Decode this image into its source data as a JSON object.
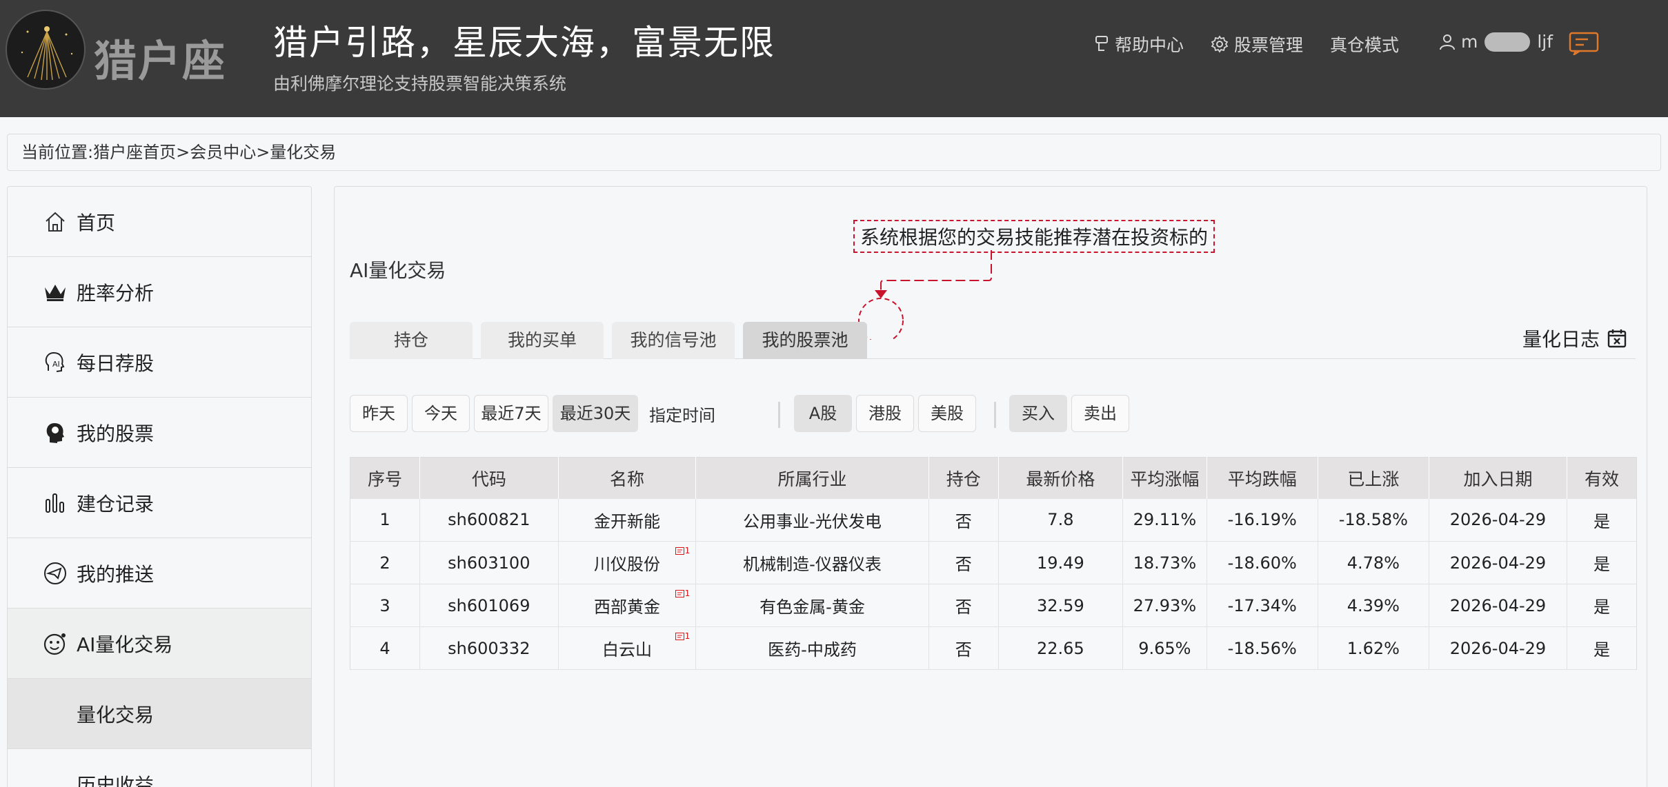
{
  "header": {
    "logo_text": "猎户座",
    "slogan": "猎户引路，星辰大海，富景无限",
    "subslogan": "由利佛摩尔理论支持股票智能决策系统",
    "nav": {
      "help": "帮助中心",
      "stock_manage": "股票管理",
      "real_mode": "真仓模式",
      "user_prefix": "m",
      "user_suffix": "ljf"
    }
  },
  "breadcrumb": "当前位置:猎户座首页>会员中心>量化交易",
  "sidebar": {
    "items": [
      {
        "label": "首页",
        "icon": "home-icon"
      },
      {
        "label": "胜率分析",
        "icon": "crown-icon"
      },
      {
        "label": "每日荐股",
        "icon": "ai-head-icon"
      },
      {
        "label": "我的股票",
        "icon": "brain-head-icon"
      },
      {
        "label": "建仓记录",
        "icon": "bar-chart-icon"
      },
      {
        "label": "我的推送",
        "icon": "push-icon"
      },
      {
        "label": "AI量化交易",
        "icon": "robot-face-icon"
      },
      {
        "label": "量化交易"
      },
      {
        "label": "历史收益"
      }
    ]
  },
  "main": {
    "title": "AI量化交易",
    "tip": "系统根据您的交易技能推荐潜在投资标的",
    "tabs": [
      "持仓",
      "我的买单",
      "我的信号池",
      "我的股票池"
    ],
    "active_tab": "我的股票池",
    "quant_log": "量化日志",
    "time_filters": [
      "昨天",
      "今天",
      "最近7天",
      "最近30天"
    ],
    "active_time_filter": "最近30天",
    "custom_time_label": "指定时间",
    "market_filters": [
      "A股",
      "港股",
      "美股"
    ],
    "active_market": "A股",
    "trade_filters": [
      "买入",
      "卖出"
    ],
    "active_trade": "买入"
  },
  "table": {
    "headers": [
      "序号",
      "代码",
      "名称",
      "所属行业",
      "持仓",
      "最新价格",
      "平均涨幅",
      "平均跌幅",
      "已上涨",
      "加入日期",
      "有效"
    ],
    "rows": [
      [
        "1",
        "sh600821",
        "金开新能",
        "公用事业-光伏发电",
        "否",
        "7.8",
        "29.11%",
        "-16.19%",
        "-18.58%",
        "2026-04-29",
        "是"
      ],
      [
        "2",
        "sh603100",
        "川仪股份",
        "机械制造-仪器仪表",
        "否",
        "19.49",
        "18.73%",
        "-18.60%",
        "4.78%",
        "2026-04-29",
        "是"
      ],
      [
        "3",
        "sh601069",
        "西部黄金",
        "有色金属-黄金",
        "否",
        "32.59",
        "27.93%",
        "-17.34%",
        "4.39%",
        "2026-04-29",
        "是"
      ],
      [
        "4",
        "sh600332",
        "白云山",
        "医药-中成药",
        "否",
        "22.65",
        "9.65%",
        "-18.56%",
        "1.62%",
        "2026-04-29",
        "是"
      ]
    ],
    "report_badge": "1"
  },
  "colors": {
    "header_bg": "#3a3a3a",
    "accent_orange": "#e07a2a",
    "tip_red": "#c9122b"
  }
}
